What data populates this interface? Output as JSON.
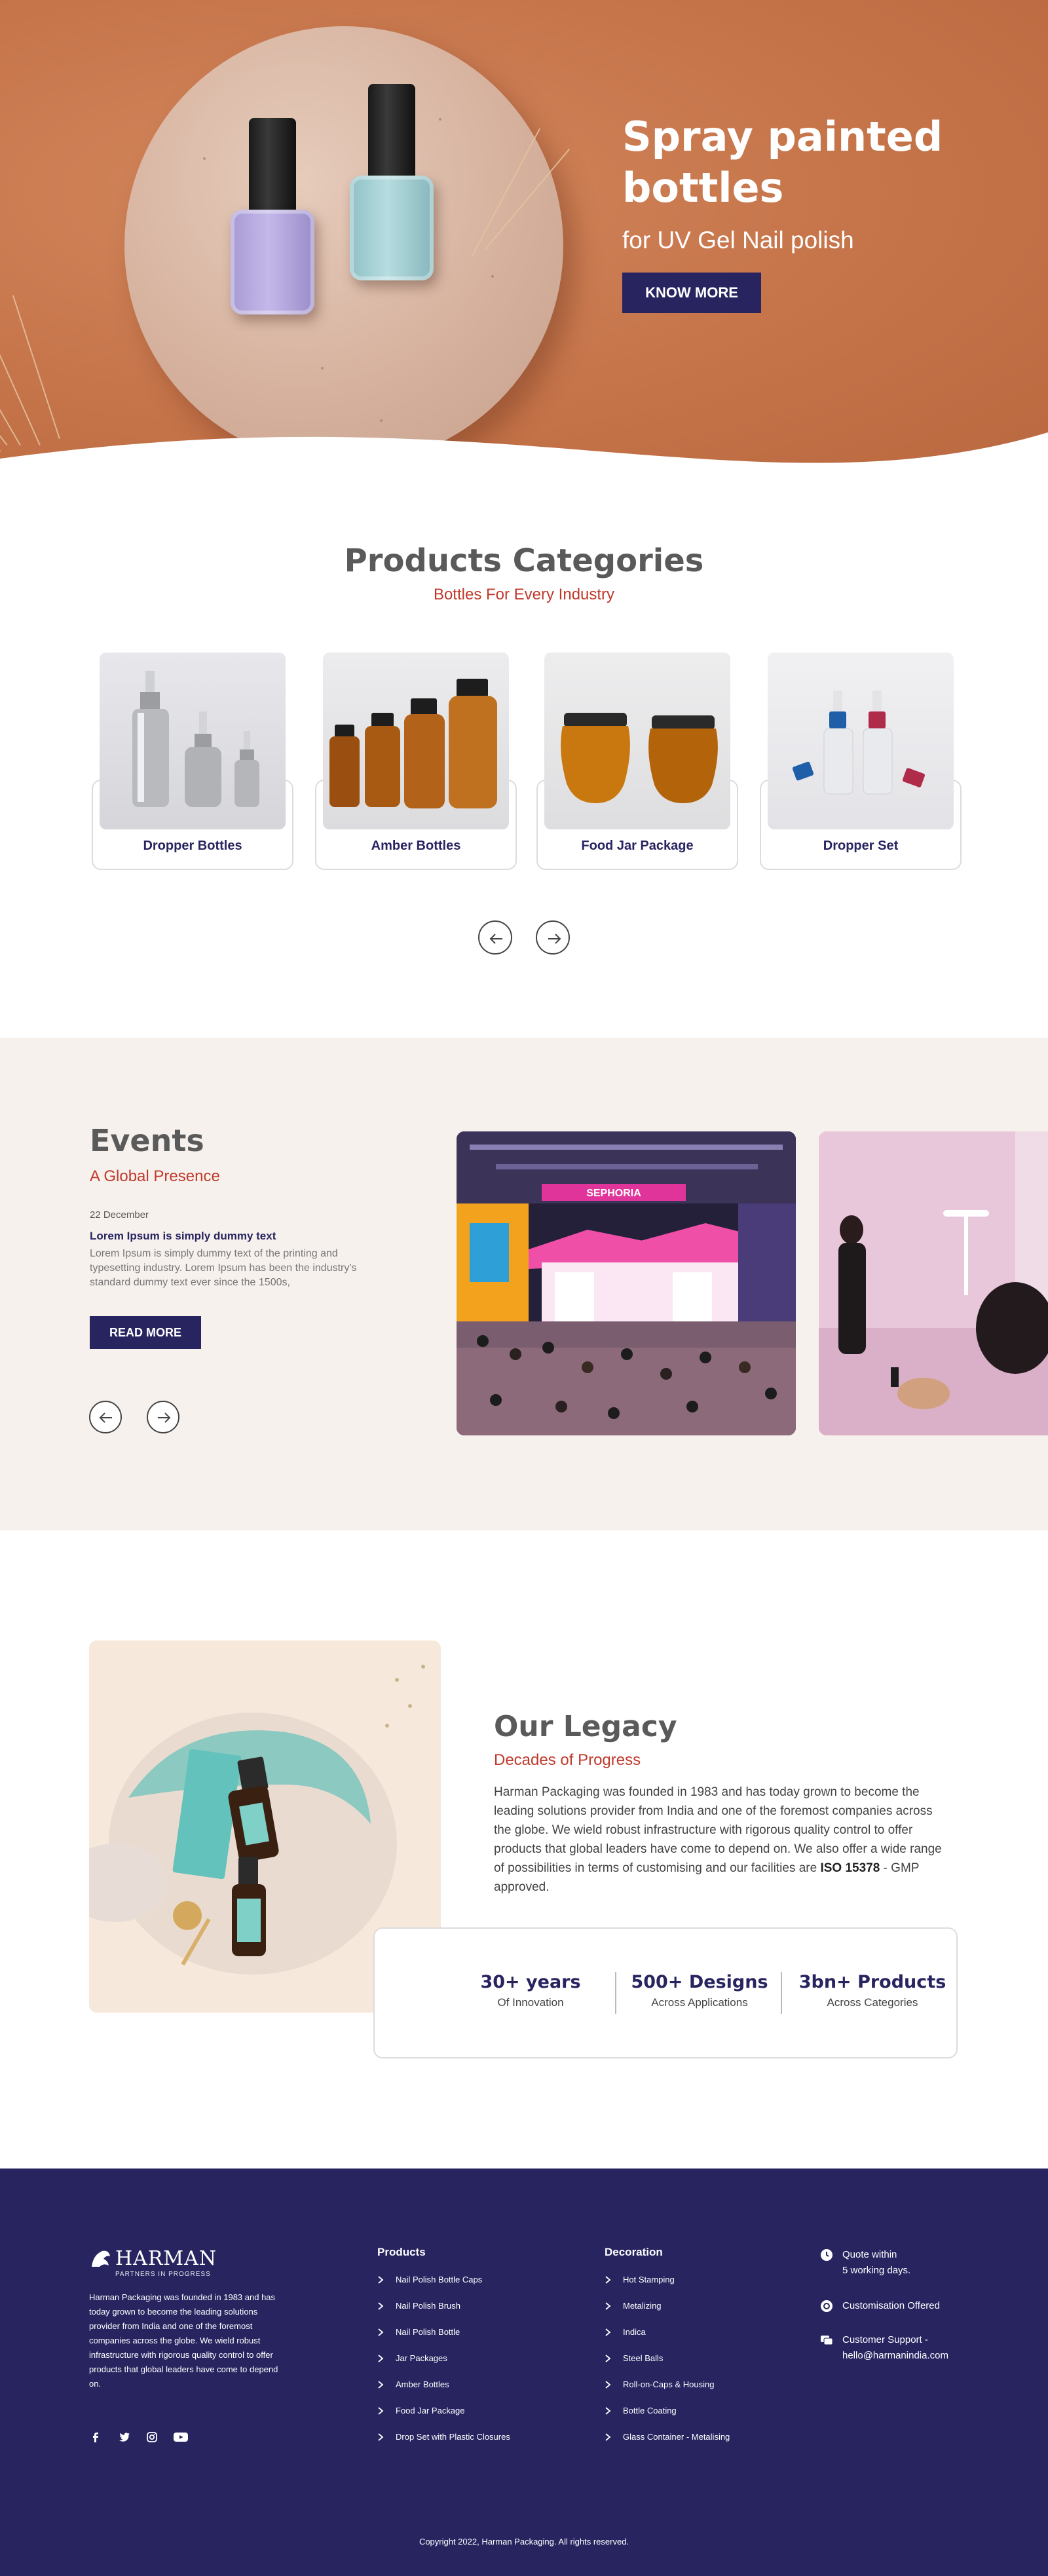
{
  "hero": {
    "title": "Spray painted bottles",
    "subtitle": "for UV Gel Nail polish",
    "button_label": "KNOW MORE"
  },
  "categories": {
    "title": "Products Categories",
    "subtitle": "Bottles For Every Industry",
    "items": [
      {
        "label": "Dropper Bottles"
      },
      {
        "label": "Amber Bottles"
      },
      {
        "label": "Food Jar Package"
      },
      {
        "label": "Dropper Set"
      }
    ]
  },
  "events": {
    "title": "Events",
    "subtitle": "A Global Presence",
    "date": "22 December",
    "headline": "Lorem Ipsum is simply dummy text",
    "body": "Lorem Ipsum is simply dummy text of the printing and typesetting industry. Lorem Ipsum has been the industry's standard dummy text ever since the 1500s,",
    "button_label": "READ MORE",
    "photo_sign": "SEPHORIA"
  },
  "legacy": {
    "title": "Our Legacy",
    "subtitle": "Decades of Progress",
    "body_before": "Harman Packaging was founded in 1983 and has today grown to become the leading solutions provider from India and one of the foremost companies across the globe. We wield robust infrastructure with rigorous quality control to offer products that global leaders have come to depend on. We also offer a wide range of possibilities in terms of customising and our facilities are ",
    "body_bold": "ISO 15378",
    "body_after": " - GMP approved.",
    "stats": [
      {
        "value": "30+ years",
        "label": "Of Innovation"
      },
      {
        "value": "500+ Designs",
        "label": "Across Applications"
      },
      {
        "value": "3bn+ Products",
        "label": "Across Categories"
      }
    ]
  },
  "footer": {
    "logo_text": "HARMAN",
    "logo_tagline": "PARTNERS IN PROGRESS",
    "about": "Harman Packaging was founded in 1983 and has today grown to become the leading solutions provider from India and one of the foremost companies across the globe. We wield robust infrastructure with rigorous quality control to offer products that global leaders have come to depend on.",
    "products_title": "Products",
    "products": [
      "Nail Polish Bottle Caps",
      "Nail Polish Brush",
      "Nail Polish Bottle",
      "Jar Packages",
      "Amber Bottles",
      "Food Jar Package",
      "Drop Set with Plastic Closures"
    ],
    "decoration_title": "Decoration",
    "decoration": [
      "Hot Stamping",
      "Metalizing",
      "Indica",
      "Steel Balls",
      "Roll-on-Caps & Housing",
      "Bottle Coating",
      "Glass Container - Metalising"
    ],
    "contact": [
      {
        "line1": "Quote within",
        "line2": "5 working days."
      },
      {
        "line1": "Customisation Offered",
        "line2": ""
      },
      {
        "line1": "Customer Support -",
        "line2": "hello@harmanindia.com"
      }
    ],
    "copyright": "Copyright 2022, Harman Packaging. All rights reserved."
  },
  "colors": {
    "brand_navy": "#272460",
    "accent_red": "#c0392b",
    "hero_orange": "#c9794f",
    "events_bg": "#f7f1ed"
  }
}
